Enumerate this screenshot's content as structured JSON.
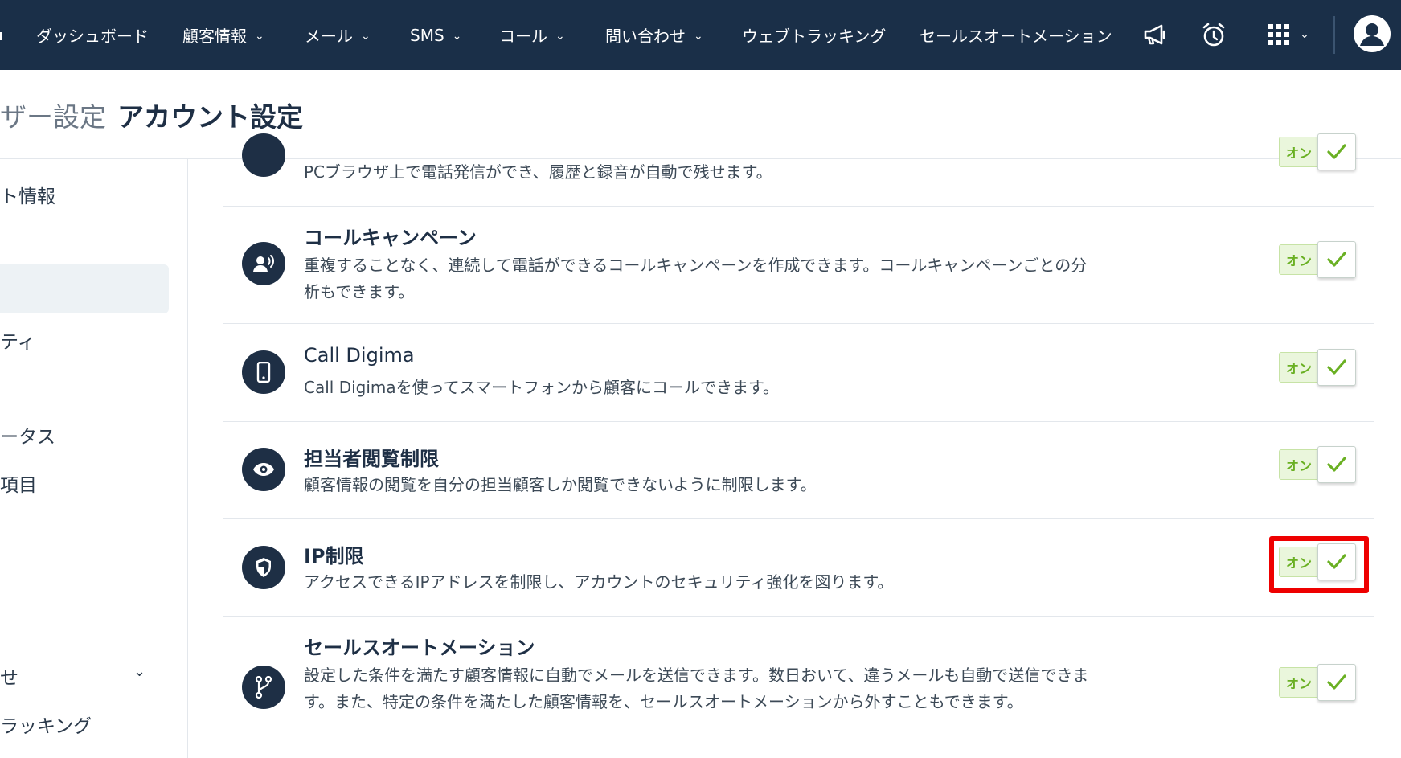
{
  "topnav": {
    "items": [
      {
        "label": "ダッシュボード",
        "dropdown": false
      },
      {
        "label": "顧客情報",
        "dropdown": true
      },
      {
        "label": "メール",
        "dropdown": true
      },
      {
        "label": "SMS",
        "dropdown": true
      },
      {
        "label": "コール",
        "dropdown": true
      },
      {
        "label": "問い合わせ",
        "dropdown": true
      },
      {
        "label": "ウェブトラッキング",
        "dropdown": false
      },
      {
        "label": "セールスオートメーション",
        "dropdown": false
      }
    ],
    "icons": [
      "megaphone-icon",
      "alarm-clock-icon",
      "apps-grid-icon",
      "user-avatar-icon"
    ]
  },
  "header": {
    "breadcrumb_prev": "ザー設定",
    "title": "アカウント設定"
  },
  "sidebar": {
    "items": [
      "ト情報",
      "ティ",
      "ータス",
      "項目",
      "せ",
      "ラッキング"
    ]
  },
  "features": [
    {
      "title": "",
      "desc": "PCブラウザ上で電話発信ができ、履歴と録音が自動で残せます。",
      "toggle": "オン",
      "icon": "phone-icon"
    },
    {
      "title": "コールキャンペーン",
      "desc": "重複することなく、連続して電話ができるコールキャンペーンを作成できます。コールキャンペーンごとの分析もできます。",
      "toggle": "オン",
      "icon": "call-campaign-icon"
    },
    {
      "title": "Call Digima",
      "desc": "Call Digimaを使ってスマートフォンから顧客にコールできます。",
      "toggle": "オン",
      "icon": "smartphone-icon"
    },
    {
      "title": "担当者閲覧制限",
      "desc": "顧客情報の閲覧を自分の担当顧客しか閲覧できないように制限します。",
      "toggle": "オン",
      "icon": "eye-icon"
    },
    {
      "title": "IP制限",
      "desc": "アクセスできるIPアドレスを制限し、アカウントのセキュリティ強化を図ります。",
      "toggle": "オン",
      "icon": "shield-icon"
    },
    {
      "title": "セールスオートメーション",
      "desc": "設定した条件を満たす顧客情報に自動でメールを送信できます。数日おいて、違うメールも自動で送信できます。また、特定の条件を満たした顧客情報を、セールスオートメーションから外すこともできます。",
      "toggle": "オン",
      "icon": "branch-icon"
    }
  ],
  "colors": {
    "nav_bg": "#1a2f48",
    "toggle_label_bg": "#eaf6dc",
    "toggle_check": "#6ab023",
    "highlight": "#ee0000"
  }
}
